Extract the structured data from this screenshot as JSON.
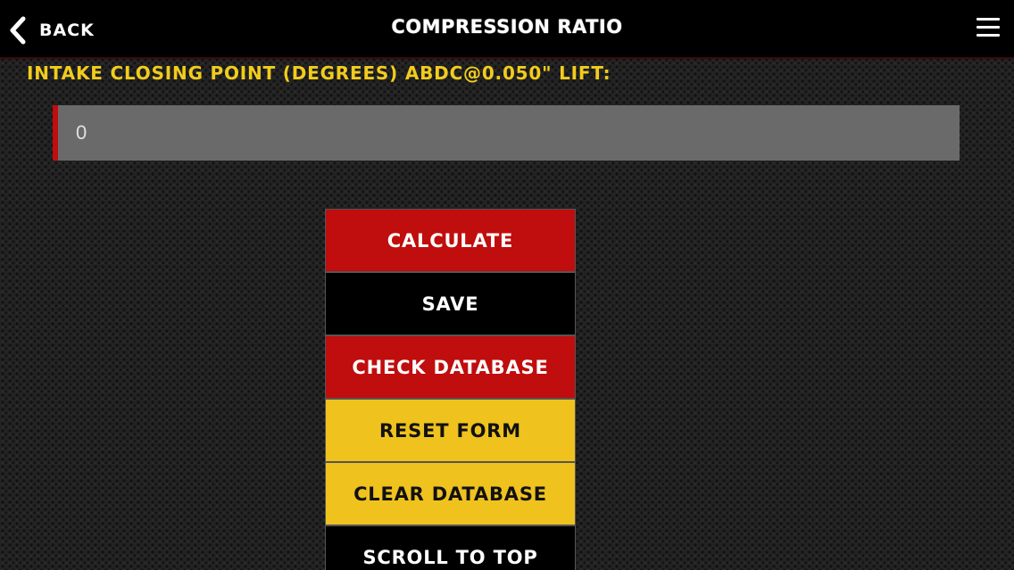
{
  "header": {
    "back_label": "Back",
    "title": "Compression Ratio",
    "menu_icon": "hamburger-menu-icon",
    "back_icon": "chevron-left-icon"
  },
  "form": {
    "field_label": "Intake Closing Point (Degrees) ABDC@0.050\" Lift:",
    "field_value": "0"
  },
  "buttons": {
    "calculate": "Calculate",
    "save": "Save",
    "check_database": "Check Database",
    "reset_form": "Reset Form",
    "clear_database": "Clear Database",
    "scroll_to_top": "Scroll To Top"
  },
  "colors": {
    "accent_red": "#c00d0d",
    "accent_yellow": "#efc21e",
    "label_yellow": "#f2cc1c",
    "header_bg": "#000000"
  }
}
